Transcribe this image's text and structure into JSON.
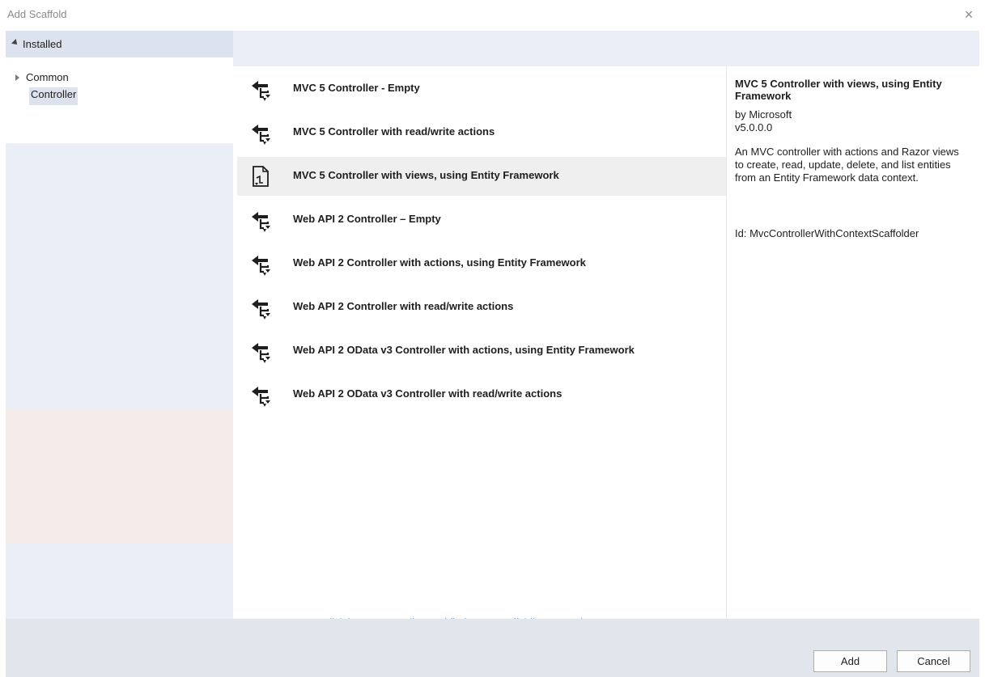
{
  "window": {
    "title": "Add Scaffold",
    "close_glyph": "×"
  },
  "left": {
    "header": "Installed",
    "tree": [
      {
        "label": "Common",
        "expandable": true
      },
      {
        "label": "Controller",
        "selected": true
      }
    ]
  },
  "items": [
    {
      "label": "MVC 5 Controller - Empty",
      "icon": "controller-icon"
    },
    {
      "label": "MVC 5 Controller with read/write actions",
      "icon": "controller-icon"
    },
    {
      "label": "MVC 5 Controller with views, using Entity Framework",
      "icon": "document-scaffold-icon",
      "selected": true
    },
    {
      "label": "Web API 2 Controller – Empty",
      "icon": "controller-icon"
    },
    {
      "label": "Web API 2 Controller with actions, using Entity Framework",
      "icon": "controller-icon"
    },
    {
      "label": "Web API 2 Controller with read/write actions",
      "icon": "controller-icon"
    },
    {
      "label": "Web API 2 OData v3 Controller with actions, using Entity Framework",
      "icon": "controller-icon"
    },
    {
      "label": "Web API 2 OData v3 Controller with read/write actions",
      "icon": "controller-icon"
    }
  ],
  "online_link": "Click here to go online and find more scaffolding extensions.",
  "detail": {
    "title": "MVC 5 Controller with views, using Entity Framework",
    "by": "by Microsoft",
    "version": "v5.0.0.0",
    "description": "An MVC controller with actions and Razor views to create, read, update, delete, and list entities from an Entity Framework data context.",
    "id": "Id: MvcControllerWithContextScaffolder"
  },
  "buttons": {
    "add": "Add",
    "cancel": "Cancel"
  },
  "colors": {
    "pane_bg": "#e9eef7",
    "selected_bg": "#efefef",
    "link": "#1a5fb4",
    "footer_bg": "#e1e5ec"
  }
}
